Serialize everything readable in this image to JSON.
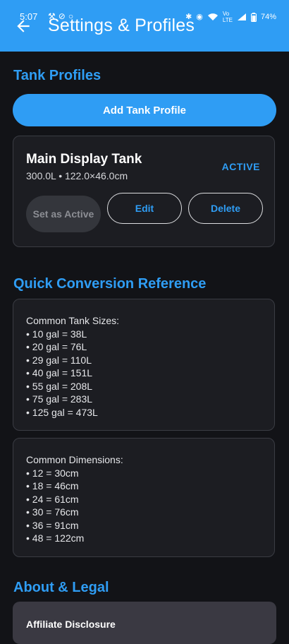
{
  "status_bar": {
    "time": "5:07",
    "left_icons": [
      "notification-icon",
      "check-circle-icon",
      "circle-icon"
    ],
    "right_icons": [
      "bluetooth-icon",
      "location-icon",
      "wifi-icon",
      "volte-icon",
      "signal-icon"
    ],
    "battery": "74%"
  },
  "app_bar": {
    "title": "Settings & Profiles",
    "back_icon": "arrow-left-icon",
    "color": "#2f9df4"
  },
  "tank_profiles": {
    "header": "Tank Profiles",
    "add_button": "Add Tank Profile",
    "profiles": [
      {
        "name": "Main Display Tank",
        "meta": "300.0L • 122.0×46.0cm",
        "status": "ACTIVE",
        "set_active_label": "Set as Active",
        "edit_label": "Edit",
        "delete_label": "Delete"
      }
    ]
  },
  "conversion": {
    "header": "Quick Conversion Reference",
    "tank_sizes": {
      "title": "Common Tank Sizes:",
      "items": [
        "• 10 gal = 38L",
        "• 20 gal = 76L",
        "• 29 gal = 110L",
        "• 40 gal = 151L",
        "• 55 gal = 208L",
        "• 75 gal = 283L",
        "• 125 gal = 473L"
      ]
    },
    "dimensions": {
      "title": "Common Dimensions:",
      "items": [
        "• 12 = 30cm",
        "• 18 = 46cm",
        "• 24 = 61cm",
        "• 30 = 76cm",
        "• 36 = 91cm",
        "• 48 = 122cm"
      ]
    }
  },
  "about": {
    "header": "About & Legal",
    "affiliate_title": "Affiliate Disclosure"
  }
}
